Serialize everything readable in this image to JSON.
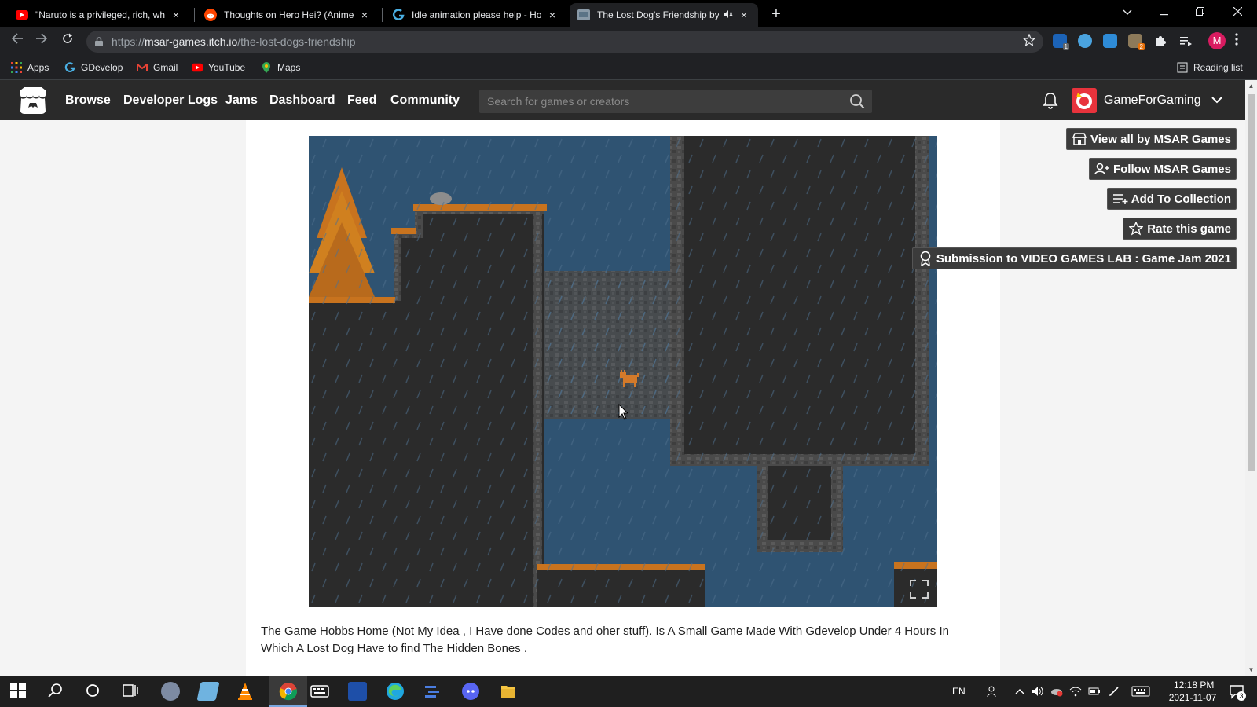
{
  "browser": {
    "tabs": [
      {
        "title": "\"Naruto is a privileged, rich, white",
        "icon": "youtube-icon"
      },
      {
        "title": "Thoughts on Hero Hei? (Anime Y",
        "icon": "reddit-icon"
      },
      {
        "title": "Idle animation please help - How",
        "icon": "gdevelop-icon"
      },
      {
        "title": "The Lost Dog's Friendship by",
        "icon": "itch-icon"
      }
    ],
    "tab_close": "×",
    "new_tab": "+",
    "url_prefix": "https://",
    "url_host": "msar-games.itch.io",
    "url_path": "/the-lost-dogs-friendship",
    "profile_initial": "M",
    "bookmarks": [
      {
        "label": "Apps"
      },
      {
        "label": "GDevelop"
      },
      {
        "label": "Gmail"
      },
      {
        "label": "YouTube"
      },
      {
        "label": "Maps"
      }
    ],
    "reading_list": "Reading list",
    "extension_badge_1": "1",
    "extension_badge_2": "2"
  },
  "itch": {
    "nav": [
      "Browse",
      "Developer Logs",
      "Jams",
      "Dashboard",
      "Feed",
      "Community"
    ],
    "search_placeholder": "Search for games or creators",
    "username": "GameForGaming"
  },
  "actions": {
    "view_all": "View all by MSAR Games",
    "follow": "Follow MSAR Games",
    "collection": "Add To Collection",
    "rate": "Rate this game",
    "submission": "Submission to VIDEO GAMES LAB : Game Jam 2021"
  },
  "description": "The Game Hobbs Home (Not My Idea , I Have done Codes and oher stuff). Is A Small Game Made With Gdevelop Under 4 Hours In Which A Lost Dog Have to find The Hidden Bones .",
  "taskbar": {
    "language": "EN",
    "time": "12:18 PM",
    "date": "2021-11-07",
    "notifications": "3"
  },
  "colors": {
    "itch_header": "#2a2a2a",
    "game_sky": "#2f5372",
    "rock": "#2b2b2b",
    "grass": "#c8731e"
  }
}
